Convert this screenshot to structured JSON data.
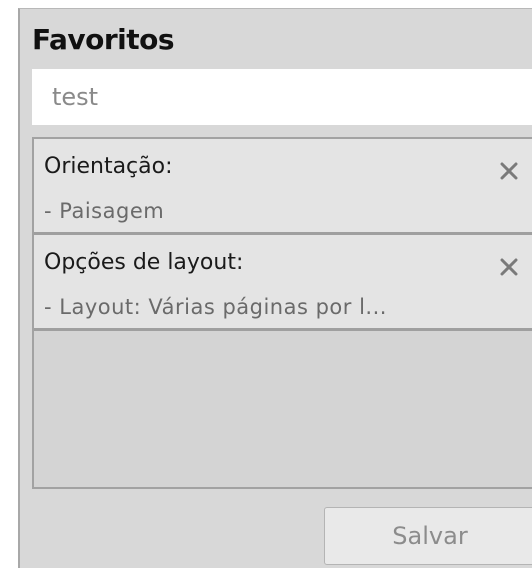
{
  "panel": {
    "title": "Favoritos"
  },
  "name_field": {
    "value": "test"
  },
  "items": [
    {
      "title": "Orientação:",
      "detail": "- Paisagem",
      "remove_icon": "close-x-icon"
    },
    {
      "title": "Opções de layout:",
      "detail": "- Layout: Várias páginas por l...",
      "remove_icon": "close-x-icon"
    }
  ],
  "footer": {
    "save_label": "Salvar"
  },
  "colors": {
    "panel_background": "#d8d8d8",
    "item_background": "#e4e4e4",
    "disabled_text": "#8c8c8c"
  }
}
